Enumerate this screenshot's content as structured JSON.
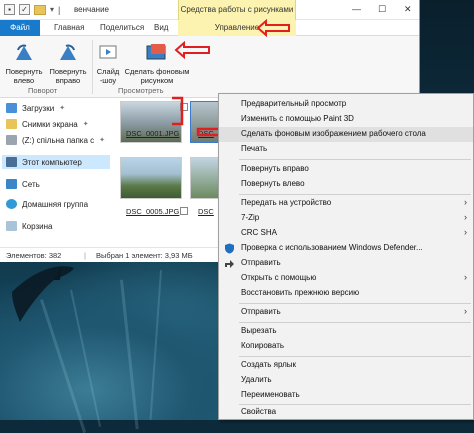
{
  "window": {
    "title": "венчание",
    "contextual_group": "Средства работы с рисунками"
  },
  "tabs": [
    {
      "label": "Файл"
    },
    {
      "label": "Главная"
    },
    {
      "label": "Поделиться"
    },
    {
      "label": "Вид"
    },
    {
      "label": "Управление"
    }
  ],
  "ribbon": {
    "rotate_left": [
      "Повернуть",
      "влево"
    ],
    "rotate_right": [
      "Повернуть",
      "вправо"
    ],
    "slideshow": [
      "Слайд",
      "-шоу"
    ],
    "set_background": [
      "Сделать фоновым",
      "рисунком"
    ],
    "group_rotate": "Поворот",
    "group_view": "Просмотреть"
  },
  "nav": {
    "items": [
      {
        "label": "Загрузки",
        "icon": "download-icon",
        "pinned": true
      },
      {
        "label": "Снимки экрана",
        "icon": "folder-icon",
        "pinned": true
      },
      {
        "label": "(Z:) спільна папка с",
        "icon": "network-drive-icon",
        "pinned": true
      },
      {
        "label": "Этот компьютер",
        "icon": "computer-icon",
        "selected": true
      },
      {
        "label": "Сеть",
        "icon": "network-icon"
      },
      {
        "label": "Домашняя группа",
        "icon": "homegroup-icon"
      },
      {
        "label": "Корзина",
        "icon": "recycle-bin-icon"
      }
    ]
  },
  "files": [
    {
      "name": "DSC_0001.JPG"
    },
    {
      "name": "DSC"
    },
    {
      "name": "DSC_0005.JPG"
    },
    {
      "name": "DSC"
    }
  ],
  "status": {
    "count": "Элементов: 382",
    "selected": "Выбран 1 элемент: 3,93 МБ"
  },
  "context_menu": {
    "items": [
      {
        "label": "Предварительный просмотр"
      },
      {
        "label": "Изменить с помощью Paint 3D"
      },
      {
        "label": "Сделать фоновым изображением рабочего стола",
        "highlighted": true
      },
      {
        "label": "Печать"
      },
      {
        "sep": true
      },
      {
        "label": "Повернуть вправо"
      },
      {
        "label": "Повернуть влево"
      },
      {
        "sep": true
      },
      {
        "label": "Передать на устройство",
        "submenu": true
      },
      {
        "label": "7-Zip",
        "submenu": true
      },
      {
        "label": "CRC SHA",
        "submenu": true
      },
      {
        "label": "Проверка с использованием Windows Defender...",
        "icon": "defender-icon"
      },
      {
        "label": "Отправить",
        "icon": "share-icon"
      },
      {
        "label": "Открыть с помощью",
        "submenu": true
      },
      {
        "label": "Восстановить прежнюю версию"
      },
      {
        "sep": true
      },
      {
        "label": "Отправить",
        "submenu": true
      },
      {
        "sep": true
      },
      {
        "label": "Вырезать"
      },
      {
        "label": "Копировать"
      },
      {
        "sep": true
      },
      {
        "label": "Создать ярлык"
      },
      {
        "label": "Удалить"
      },
      {
        "label": "Переименовать"
      },
      {
        "sep": true
      },
      {
        "label": "Свойства"
      }
    ]
  },
  "colors": {
    "file_tab": "#1979ca",
    "contextual_tab": "#fcf3b0",
    "annotation_arrow": "#e02020",
    "selection": "#cce8ff"
  }
}
